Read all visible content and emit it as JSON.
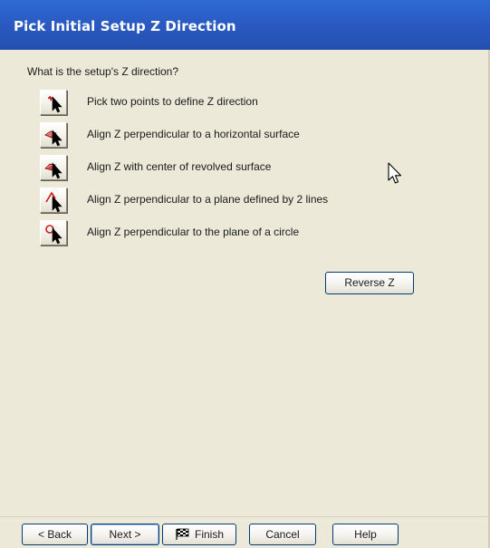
{
  "window": {
    "title": "Pick Initial Setup Z Direction"
  },
  "main": {
    "question": "What is the setup's Z direction?",
    "options": [
      {
        "label": "Pick two points to define Z direction",
        "icon": "two-points-cursor-icon"
      },
      {
        "label": "Align Z perpendicular to a  horizontal surface",
        "icon": "surface-cursor-icon"
      },
      {
        "label": "Align Z with center of revolved surface",
        "icon": "revolved-surface-cursor-icon"
      },
      {
        "label": "Align Z perpendicular to a plane defined by 2 lines",
        "icon": "two-lines-cursor-icon"
      },
      {
        "label": "Align Z perpendicular to the plane of a circle",
        "icon": "circle-cursor-icon"
      }
    ],
    "reverse_label": "Reverse Z"
  },
  "footer": {
    "back_label": "< Back",
    "next_label": "Next >",
    "finish_label": "Finish",
    "cancel_label": "Cancel",
    "help_label": "Help"
  },
  "colors": {
    "title_bar": "#2a5bc3",
    "background": "#ece9d8",
    "button_border": "#003c74",
    "icon_accent": "#cc1a1a"
  }
}
